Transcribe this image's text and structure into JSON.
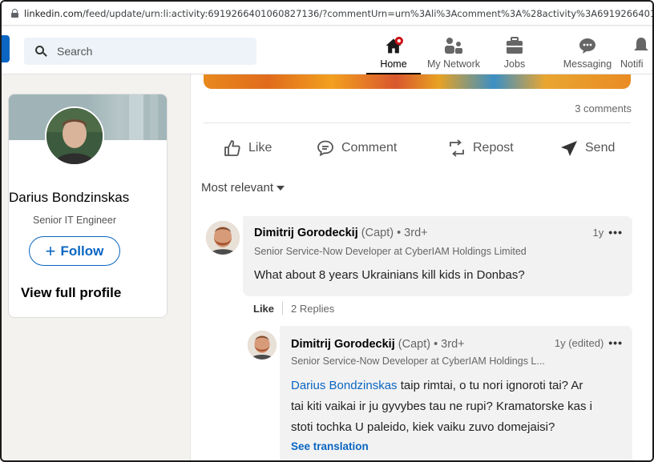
{
  "browser": {
    "url_host": "linkedin.com",
    "url_path": "/feed/update/urn:li:activity:6919266401060827136/?commentUrn=urn%3Ali%3Acomment%3A%28activity%3A6919266401060827136%2"
  },
  "nav": {
    "search_placeholder": "Search",
    "items": [
      {
        "label": "Home",
        "icon": "home-icon",
        "active": true
      },
      {
        "label": "My Network",
        "icon": "network-icon"
      },
      {
        "label": "Jobs",
        "icon": "jobs-icon"
      },
      {
        "label": "Messaging",
        "icon": "messaging-icon"
      },
      {
        "label": "Notifi",
        "icon": "notifications-icon"
      }
    ],
    "accent": "#0a66c2",
    "badge_color": "#cc1016"
  },
  "profile": {
    "name": "Darius Bondzinskas",
    "title": "Senior IT Engineer",
    "follow_label": "Follow",
    "view_profile_label": "View full profile"
  },
  "post": {
    "comments_count": "3 comments",
    "actions": {
      "like": "Like",
      "comment": "Comment",
      "repost": "Repost",
      "send": "Send"
    },
    "sort_label": "Most relevant"
  },
  "comments": [
    {
      "author": "Dimitrij Gorodeckij",
      "author_meta": "(Capt) • 3rd+",
      "headline": "Senior Service-Now Developer at CyberIAM Holdings Limited",
      "time": "1y",
      "text": "What about 8 years Ukrainians kill kids in Donbas?",
      "like_label": "Like",
      "replies_label": "2 Replies"
    },
    {
      "author": "Dimitrij Gorodeckij",
      "author_meta": "(Capt) • 3rd+",
      "headline": "Senior Service-Now Developer at CyberIAM Holdings L...",
      "time": "1y (edited)",
      "mention": "Darius Bondzinskas",
      "text_line1": " taip rimtai, o tu nori ignoroti tai? Ar",
      "text_line2": "tai kiti vaikai ir ju gyvybes tau ne rupi? Kramatorske kas i",
      "text_line3": "stoti tochka U paleido, kiek vaiku zuvo domejaisi?",
      "see_translation": "See translation"
    }
  ]
}
